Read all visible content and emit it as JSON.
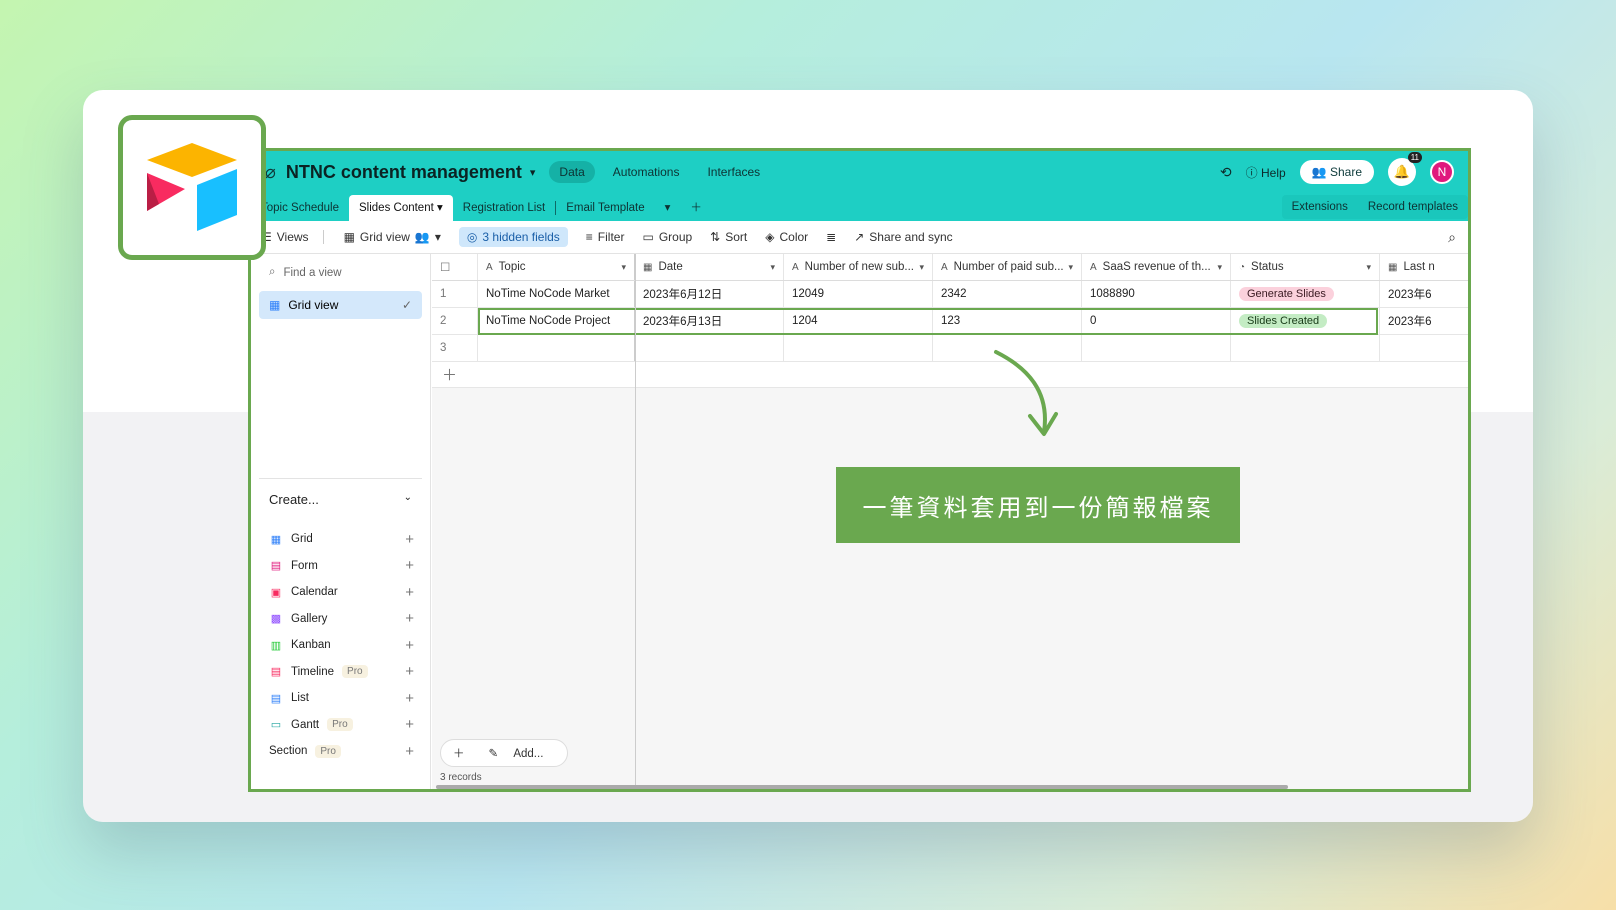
{
  "header": {
    "base_title": "NTNC content management",
    "nav": [
      "Data",
      "Automations",
      "Interfaces"
    ],
    "help_label": "Help",
    "share_label": "Share",
    "notification_count": "11",
    "avatar_initial": "N"
  },
  "tabs": {
    "items": [
      "Topic Schedule",
      "Slides Content",
      "Registration List",
      "Email Template"
    ],
    "active": "Slides Content",
    "extensions_label": "Extensions",
    "record_templates_label": "Record templates"
  },
  "toolbar": {
    "views_label": "Views",
    "grid_view_label": "Grid view",
    "hidden_fields_label": "3 hidden fields",
    "filter_label": "Filter",
    "group_label": "Group",
    "sort_label": "Sort",
    "color_label": "Color",
    "share_sync_label": "Share and sync"
  },
  "sidebar": {
    "find_placeholder": "Find a view",
    "active_view": "Grid view",
    "create_label": "Create...",
    "create_items": [
      {
        "label": "Grid",
        "icon": "grid-icon",
        "color": "#2d7ff9",
        "pro": ""
      },
      {
        "label": "Form",
        "icon": "form-icon",
        "color": "#e0197d",
        "pro": ""
      },
      {
        "label": "Calendar",
        "icon": "calendar-icon",
        "color": "#f82b60",
        "pro": ""
      },
      {
        "label": "Gallery",
        "icon": "gallery-icon",
        "color": "#8b46ff",
        "pro": ""
      },
      {
        "label": "Kanban",
        "icon": "kanban-icon",
        "color": "#20c933",
        "pro": ""
      },
      {
        "label": "Timeline",
        "icon": "timeline-icon",
        "color": "#f82b60",
        "pro": "Pro"
      },
      {
        "label": "List",
        "icon": "list-icon",
        "color": "#2d7ff9",
        "pro": ""
      },
      {
        "label": "Gantt",
        "icon": "gantt-icon",
        "color": "#20a39e",
        "pro": "Pro"
      },
      {
        "label": "Section",
        "icon": "",
        "color": "#333333",
        "pro": "Pro"
      }
    ]
  },
  "grid": {
    "columns": [
      "Topic",
      "Date",
      "Number of new sub...",
      "Number of paid sub...",
      "SaaS revenue of th...",
      "Status",
      "Last n"
    ],
    "rows": [
      {
        "num": "1",
        "topic": "NoTime NoCode Market",
        "date": "2023年6月12日",
        "new": "12049",
        "paid": "2342",
        "saas": "1088890",
        "status": "Generate Slides",
        "last": "2023年6"
      },
      {
        "num": "2",
        "topic": "NoTime NoCode Project",
        "date": "2023年6月13日",
        "new": "1204",
        "paid": "123",
        "saas": "0",
        "status": "Slides Created",
        "last": "2023年6"
      },
      {
        "num": "3",
        "topic": "",
        "date": "",
        "new": "",
        "paid": "",
        "saas": "",
        "status": "",
        "last": ""
      }
    ],
    "add_label": "Add...",
    "records_label": "3 records"
  },
  "annotation": {
    "text": "一筆資料套用到一份簡報檔案",
    "color": "#6aa84f"
  }
}
